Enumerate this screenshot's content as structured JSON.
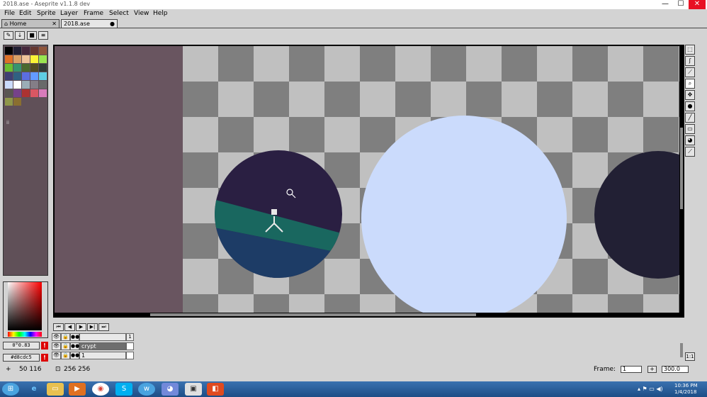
{
  "window": {
    "title": "2018.ase - Aseprite v1.1.8 dev",
    "minimize_icon": "minimize-icon",
    "maximize_icon": "maximize-icon",
    "close_icon": "close-icon"
  },
  "menu": [
    "File",
    "Edit",
    "Sprite",
    "Layer",
    "Frame",
    "Select",
    "View",
    "Help"
  ],
  "tabs": [
    {
      "label": "Home"
    },
    {
      "label": "2018.ase"
    }
  ],
  "palette": {
    "colors": [
      "#000000",
      "#222034",
      "#45283c",
      "#663931",
      "#8f563b",
      "#df7126",
      "#d9a066",
      "#eec39a",
      "#fbf236",
      "#99e550",
      "#6abe30",
      "#37946e",
      "#4b692f",
      "#524b24",
      "#323c39",
      "#3f3f74",
      "#306082",
      "#5b6ee1",
      "#639bff",
      "#5fcde4",
      "#cbdbfc",
      "#ffffff",
      "#9badb7",
      "#847e87",
      "#696a6a",
      "#595652",
      "#76428a",
      "#ac3232",
      "#d95763",
      "#d77bba",
      "#8f974a",
      "#8a6f30"
    ],
    "index_label": "ii"
  },
  "color_picker": {
    "fg_label": "0°0.83",
    "bg_label": "#d8cdc5"
  },
  "canvas": {
    "bg_color": "#695560",
    "planet_a_top": "#2a1f42",
    "planet_a_band": "#19675f",
    "planet_a_bottom": "#1d3c66",
    "planet_b": "#cbdbfc",
    "planet_c": "#222034"
  },
  "tools": [
    "marquee-icon",
    "lasso-icon",
    "eyedropper-icon",
    "zoom-icon",
    "move-icon",
    "fill-icon",
    "line-icon",
    "rectangle-icon",
    "blur-icon",
    "brush-icon"
  ],
  "timeline": {
    "buttons": [
      "⏮",
      "◀",
      "▶",
      "▶|",
      "⏭"
    ],
    "frame_header": "1",
    "layers": [
      {
        "name": "",
        "header": true
      },
      {
        "name": "crypt",
        "selected": true
      },
      {
        "name": "1"
      }
    ]
  },
  "status": {
    "position": "50 116",
    "size": "256 256",
    "frame_label": "Frame:",
    "frame_value": "1",
    "zoom_value": "300.0"
  },
  "taskbar": {
    "time": "10:36 PM",
    "date": "1/4/2018"
  }
}
